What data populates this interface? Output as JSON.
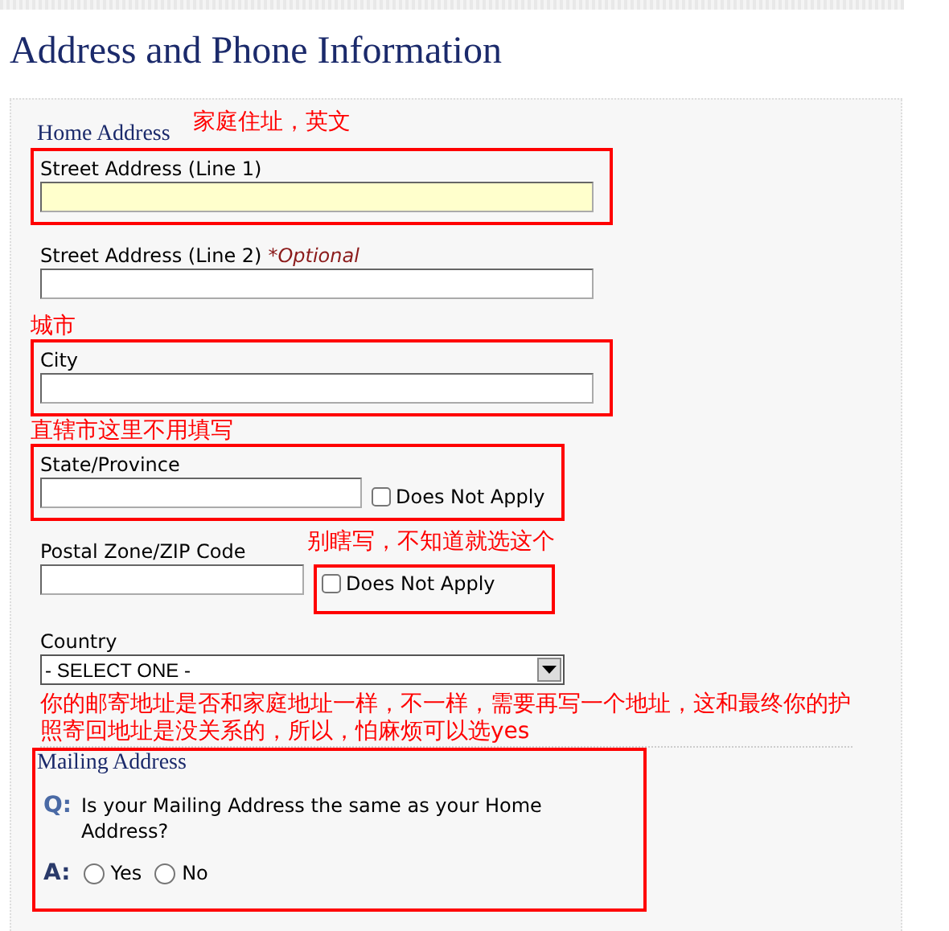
{
  "page_title": "Address and Phone Information",
  "home_address": {
    "heading": "Home Address",
    "note": "家庭住址，英文",
    "fields": [
      {
        "kind": "text",
        "label": "Street Address (Line 1)",
        "highlighted": true,
        "boxed": true
      },
      {
        "kind": "text",
        "label": "Street Address (Line 2)",
        "optional": "*Optional",
        "highlighted": false
      },
      {
        "kind": "text",
        "label": "City",
        "note": "城市",
        "highlighted": false,
        "boxed": true
      },
      {
        "kind": "text-na",
        "label": "State/Province",
        "note": "直辖市这里不用填写",
        "checkbox_label": "Does Not Apply",
        "checked": false,
        "boxed": true
      },
      {
        "kind": "text-na",
        "label": "Postal Zone/ZIP Code",
        "note": "别瞎写，不知道就选这个",
        "checkbox_label": "Does Not Apply",
        "checked": false,
        "checkbox_boxed": true
      },
      {
        "kind": "select",
        "label": "Country",
        "value": "- SELECT ONE -"
      }
    ],
    "note_after": "你的邮寄地址是否和家庭地址一样，不一样，需要再写一个地址，这和最终你的护照寄回地址是没关系的，所以，怕麻烦可以选yes"
  },
  "mailing_address": {
    "heading": "Mailing Address",
    "q_mark": "Q:",
    "question": "Is your Mailing Address the same as your Home Address?",
    "a_mark": "A:",
    "options": [
      {
        "label": "Yes",
        "selected": false
      },
      {
        "label": "No",
        "selected": false
      }
    ]
  }
}
